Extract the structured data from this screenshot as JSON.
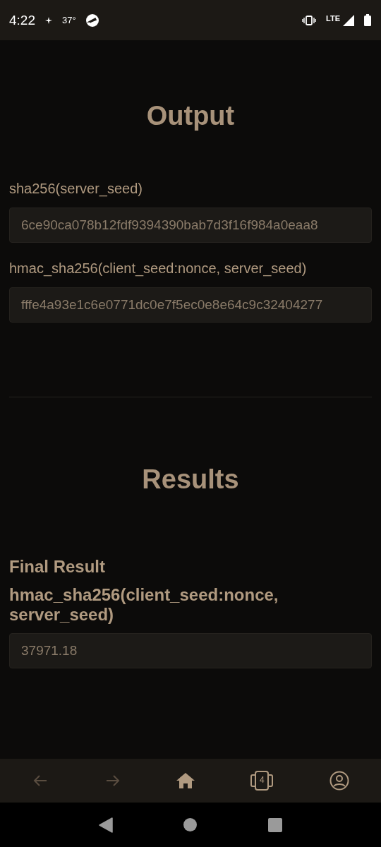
{
  "status_bar": {
    "time": "4:22",
    "temperature": "37°",
    "network": "LTE"
  },
  "output": {
    "title": "Output",
    "fields": [
      {
        "label": "sha256(server_seed)",
        "value": "6ce90ca078b12fdf9394390bab7d3f16f984a0eaa8"
      },
      {
        "label": "hmac_sha256(client_seed:nonce, server_seed)",
        "value": "fffe4a93e1c6e0771dc0e7f5ec0e8e64c9c32404277"
      }
    ]
  },
  "results": {
    "title": "Results",
    "subtitle": "Final Result",
    "label": "hmac_sha256(client_seed:nonce, server_seed)",
    "value": "37971.18"
  },
  "bottom_nav": [
    {
      "kind": "back",
      "disabled": true
    },
    {
      "kind": "forward",
      "disabled": true
    },
    {
      "kind": "home",
      "disabled": false
    },
    {
      "kind": "tabs",
      "disabled": false,
      "count": "4"
    },
    {
      "kind": "account",
      "disabled": false
    }
  ]
}
